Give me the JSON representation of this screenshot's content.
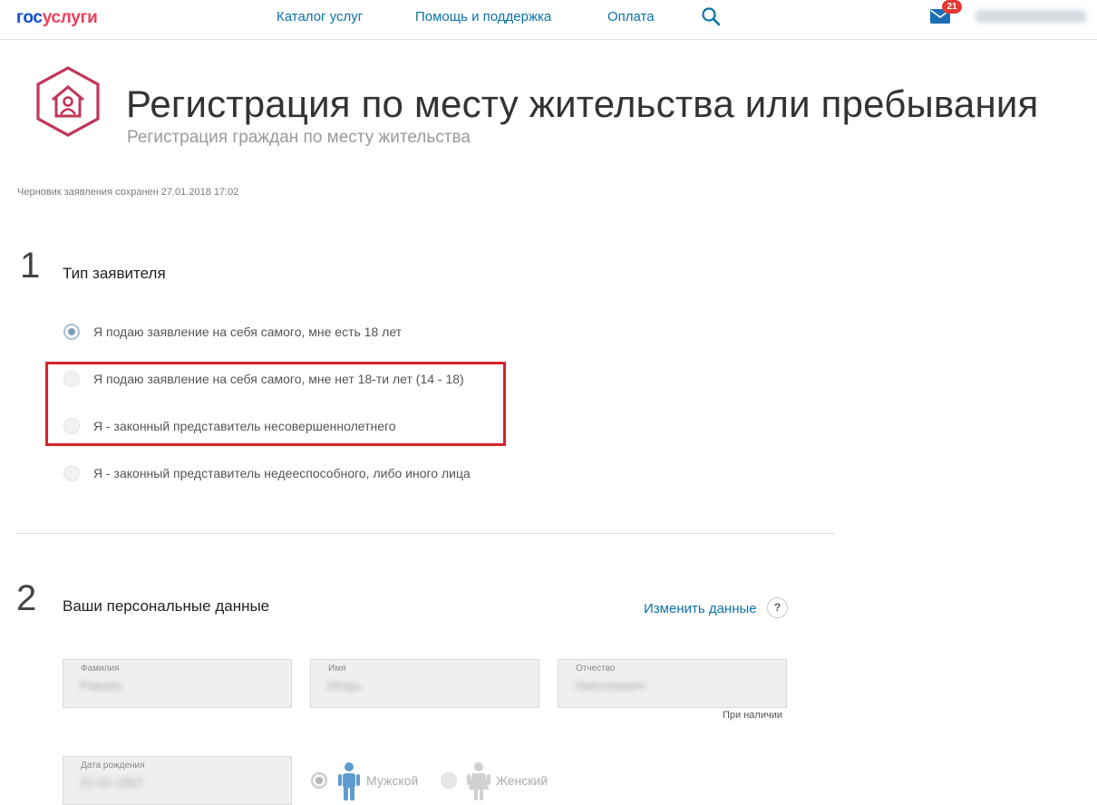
{
  "header": {
    "logo_part1": "гос",
    "logo_part2": "услуги",
    "nav": [
      "Каталог услуг",
      "Помощь и поддержка",
      "Оплата"
    ],
    "mail_badge": "21"
  },
  "service": {
    "title": "Регистрация по месту жительства или пребывания",
    "subtitle": "Регистрация граждан по месту жительства",
    "draft_status": "Черновик заявления сохранен 27.01.2018 17:02"
  },
  "step1": {
    "number": "1",
    "title": "Тип заявителя",
    "options": [
      {
        "label": "Я подаю заявление на себя самого, мне есть 18 лет",
        "selected": true
      },
      {
        "label": "Я подаю заявление на себя самого, мне нет 18-ти лет (14 - 18)",
        "selected": false
      },
      {
        "label": "Я - законный представитель несовершеннолетнего",
        "selected": false
      },
      {
        "label": "Я - законный представитель недееспособного, либо иного лица",
        "selected": false
      }
    ]
  },
  "step2": {
    "number": "2",
    "title": "Ваши персональные данные",
    "change_link": "Изменить данные",
    "help": "?",
    "fields": {
      "surname_label": "Фамилия",
      "surname_value": "Раваль",
      "name_label": "Имя",
      "name_value": "Игорь",
      "patronymic_label": "Отчество",
      "patronymic_value": "Николаевич",
      "patronymic_hint": "При наличии",
      "birthdate_label": "Дата рождения",
      "birthdate_value": "22.02.1967"
    },
    "gender": {
      "male": "Мужской",
      "female": "Женский",
      "selected": "male"
    }
  },
  "colors": {
    "link": "#0b72a8",
    "highlight": "#d8232a",
    "brand_blue": "#0d4cd3",
    "brand_red": "#ee3f58",
    "icon": "#c0365a"
  }
}
